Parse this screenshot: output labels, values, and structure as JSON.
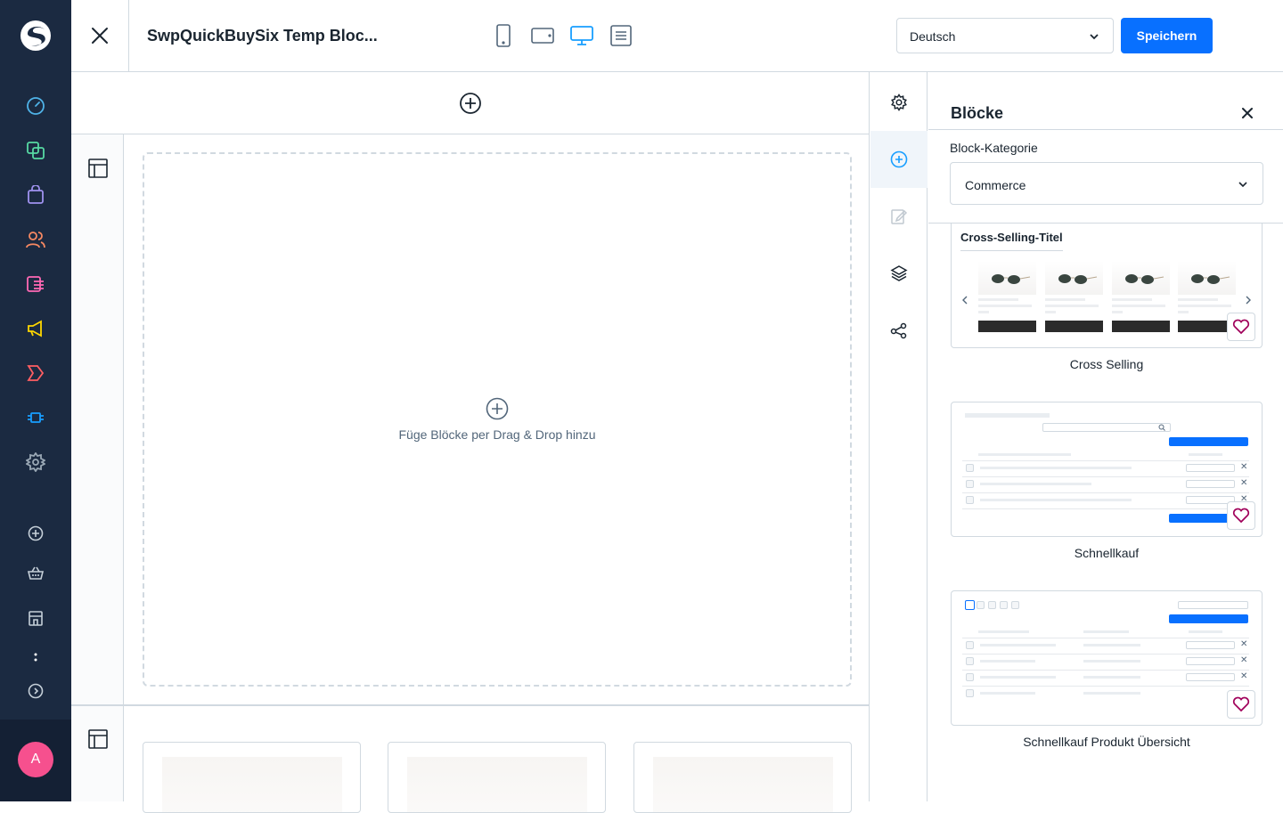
{
  "header": {
    "title": "SwpQuickBuySix Temp Bloc...",
    "language": "Deutsch",
    "save_label": "Speichern"
  },
  "canvas": {
    "dropzone_text": "Füge Blöcke per Drag & Drop hinzu"
  },
  "panel": {
    "title": "Blöcke",
    "category_label": "Block-Kategorie",
    "category_value": "Commerce",
    "blocks": [
      {
        "label": "Cross Selling",
        "preview_title": "Cross-Selling-Titel"
      },
      {
        "label": "Schnellkauf"
      },
      {
        "label": "Schnellkauf Produkt Übersicht"
      }
    ]
  },
  "user": {
    "initial": "A"
  },
  "colors": {
    "nav_bg": "#1b2a41",
    "primary": "#0870ff",
    "avatar": "#f6508e",
    "heart": "#a0005a"
  }
}
